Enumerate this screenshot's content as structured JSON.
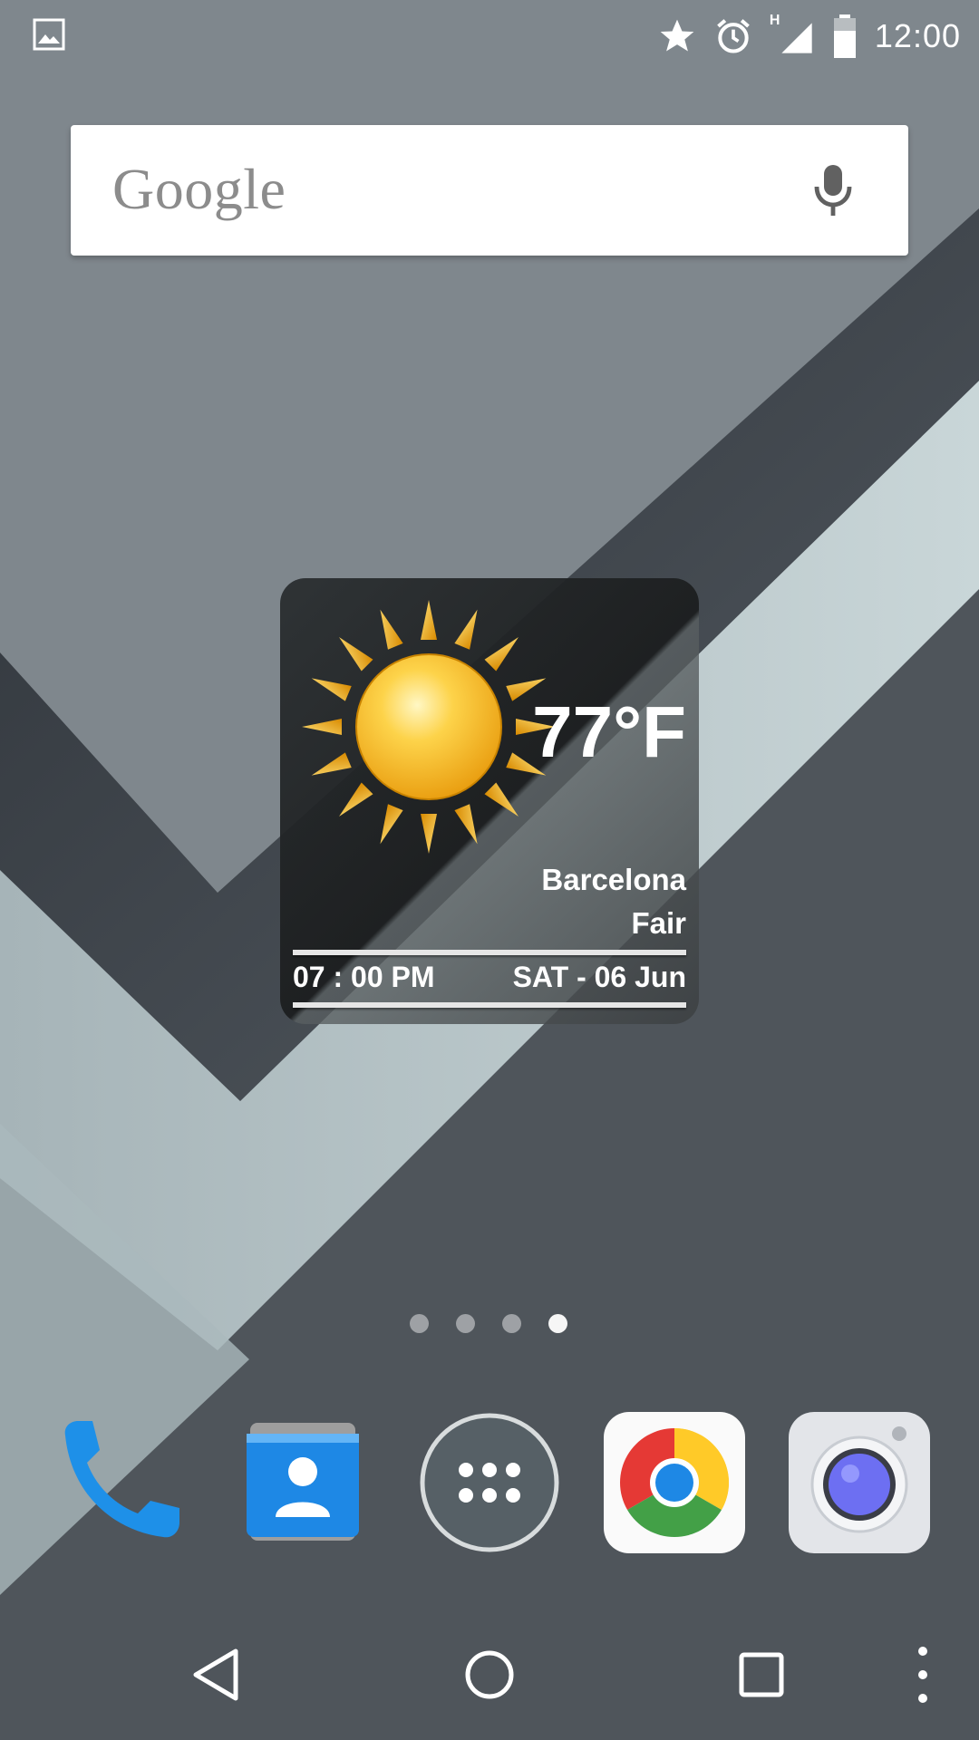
{
  "status_bar": {
    "time": "12:00",
    "network_type": "H",
    "icons": [
      "gallery-icon",
      "star-icon",
      "alarm-icon",
      "signal-icon",
      "battery-icon"
    ]
  },
  "search": {
    "logo": "Google",
    "mic_icon": "mic-icon"
  },
  "weather": {
    "temperature": "77°F",
    "city": "Barcelona",
    "condition": "Fair",
    "time": "07 : 00 PM",
    "date": "SAT - 06 Jun",
    "icon": "sun-icon"
  },
  "page_indicator": {
    "pages": 4,
    "active_index": 3
  },
  "dock": [
    {
      "app": "Phone",
      "icon": "phone-icon"
    },
    {
      "app": "Contacts",
      "icon": "contacts-icon"
    },
    {
      "app": "All apps",
      "icon": "app-drawer-icon"
    },
    {
      "app": "Chrome",
      "icon": "chrome-icon"
    },
    {
      "app": "Camera",
      "icon": "camera-icon"
    }
  ],
  "nav_bar": [
    "back-icon",
    "home-icon",
    "recents-icon",
    "overflow-menu-icon"
  ],
  "colors": {
    "wallpaper_base": "#7f878d",
    "wallpaper_dark": "#4f555b",
    "wallpaper_light": "#bccbce",
    "sun": "#f5b81d",
    "phone_blue": "#2196f3"
  }
}
